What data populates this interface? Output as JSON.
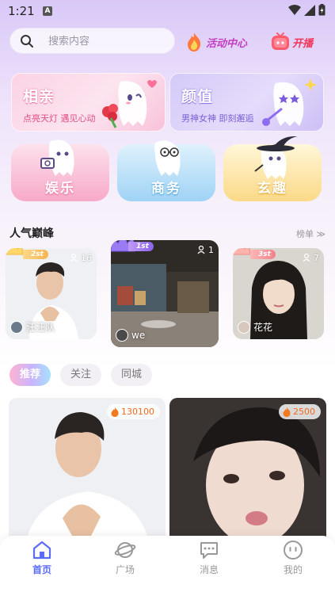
{
  "status_bar": {
    "time": "1:21",
    "notification_badge": "A"
  },
  "search": {
    "placeholder": "搜索内容"
  },
  "header_actions": {
    "activity": "活动中心",
    "go_live": "开播"
  },
  "feature_cards": [
    {
      "title": "相亲",
      "subtitle": "点亮天灯 遇见心动"
    },
    {
      "title": "颜值",
      "subtitle": "男神女神 即刻邂逅"
    }
  ],
  "category_cards": [
    {
      "title": "娱乐"
    },
    {
      "title": "商务"
    },
    {
      "title": "玄趣"
    }
  ],
  "popular": {
    "title": "人气巅峰",
    "rank_link": "榜单 ≫",
    "rooms": [
      {
        "rank": "2st",
        "viewers": "16",
        "host": "汪汪队"
      },
      {
        "rank": "1st",
        "viewers": "1",
        "host": "we"
      },
      {
        "rank": "3st",
        "viewers": "7",
        "host": "花花"
      }
    ]
  },
  "feed_tabs": [
    "推荐",
    "关注",
    "同城"
  ],
  "feed_tabs_active": "推荐",
  "feed": [
    {
      "heat": "130100"
    },
    {
      "heat": "2500"
    }
  ],
  "tabbar": [
    {
      "label": "首页",
      "icon": "home-icon",
      "active": true
    },
    {
      "label": "广场",
      "icon": "planet-icon",
      "active": false
    },
    {
      "label": "消息",
      "icon": "message-icon",
      "active": false
    },
    {
      "label": "我的",
      "icon": "profile-face-icon",
      "active": false
    }
  ],
  "colors": {
    "accent": "#5b6cf6",
    "activity": "#c43ec2",
    "live": "#f2365b",
    "heat": "#ef6a1c"
  }
}
